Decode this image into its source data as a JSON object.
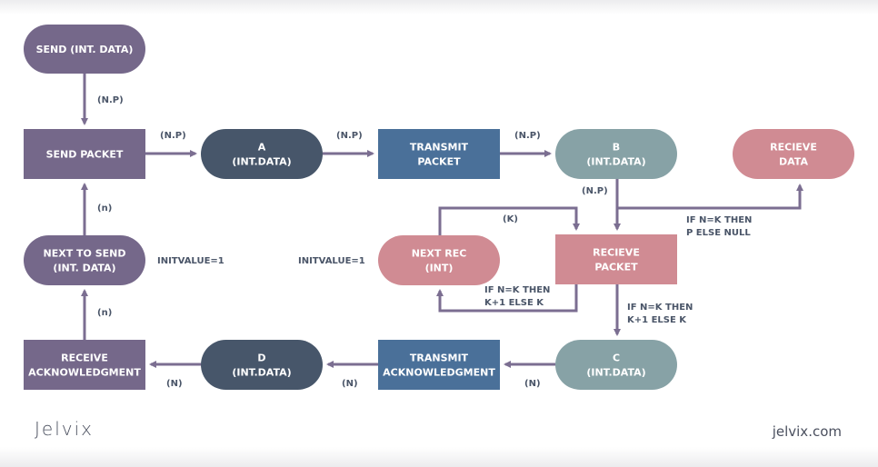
{
  "colors": {
    "purple": "#75688a",
    "navy": "#47566a",
    "blue": "#4a7099",
    "teal": "#87a2a6",
    "pink": "#d08b93",
    "edge": "#7b6e91",
    "label": "#4a5568"
  },
  "nodes": {
    "send_int_data": {
      "lines": [
        "SEND (INT. DATA)"
      ]
    },
    "send_packet": {
      "lines": [
        "SEND PACKET"
      ]
    },
    "a_int_data": {
      "lines": [
        "A",
        "(INT.DATA)"
      ]
    },
    "transmit_packet": {
      "lines": [
        "TRANSMIT",
        "PACKET"
      ]
    },
    "b_int_data": {
      "lines": [
        "B",
        "(INT.DATA)"
      ]
    },
    "recieve_data": {
      "lines": [
        "RECIEVE",
        "DATA"
      ]
    },
    "next_to_send": {
      "lines": [
        "NEXT TO SEND",
        "(INT. DATA)"
      ]
    },
    "next_rec": {
      "lines": [
        "NEXT REC",
        "(INT)"
      ]
    },
    "recieve_packet": {
      "lines": [
        "RECIEVE",
        "PACKET"
      ]
    },
    "receive_ack": {
      "lines": [
        "RECEIVE",
        "ACKNOWLEDGMENT"
      ]
    },
    "d_int_data": {
      "lines": [
        "D",
        "(INT.DATA)"
      ]
    },
    "transmit_ack": {
      "lines": [
        "TRANSMIT",
        "ACKNOWLEDGMENT"
      ]
    },
    "c_int_data": {
      "lines": [
        "C",
        "(INT.DATA)"
      ]
    }
  },
  "edge_labels": {
    "send_to_packet": "(N.P)",
    "packet_to_a": "(N.P)",
    "a_to_transmit": "(N.P)",
    "transmit_to_b": "(N.P)",
    "b_down": "(N.P)",
    "k_loop": "(K)",
    "to_recieve_data": [
      "IF N=K THEN",
      "P ELSE NULL"
    ],
    "packet_to_nextrec": [
      "IF N=K THEN",
      "K+1 ELSE K"
    ],
    "packet_to_c": [
      "IF N=K THEN",
      "K+1 ELSE K"
    ],
    "nextsend_up": "(n)",
    "ack_up": "(n)",
    "init_send": "INITVALUE=1",
    "init_rec": "INITVALUE=1",
    "d_to_ack": "(N)",
    "tack_to_d": "(N)",
    "c_to_tack": "(N)"
  },
  "footer": {
    "brand": "Jelvix",
    "site": "jelvix.com"
  }
}
